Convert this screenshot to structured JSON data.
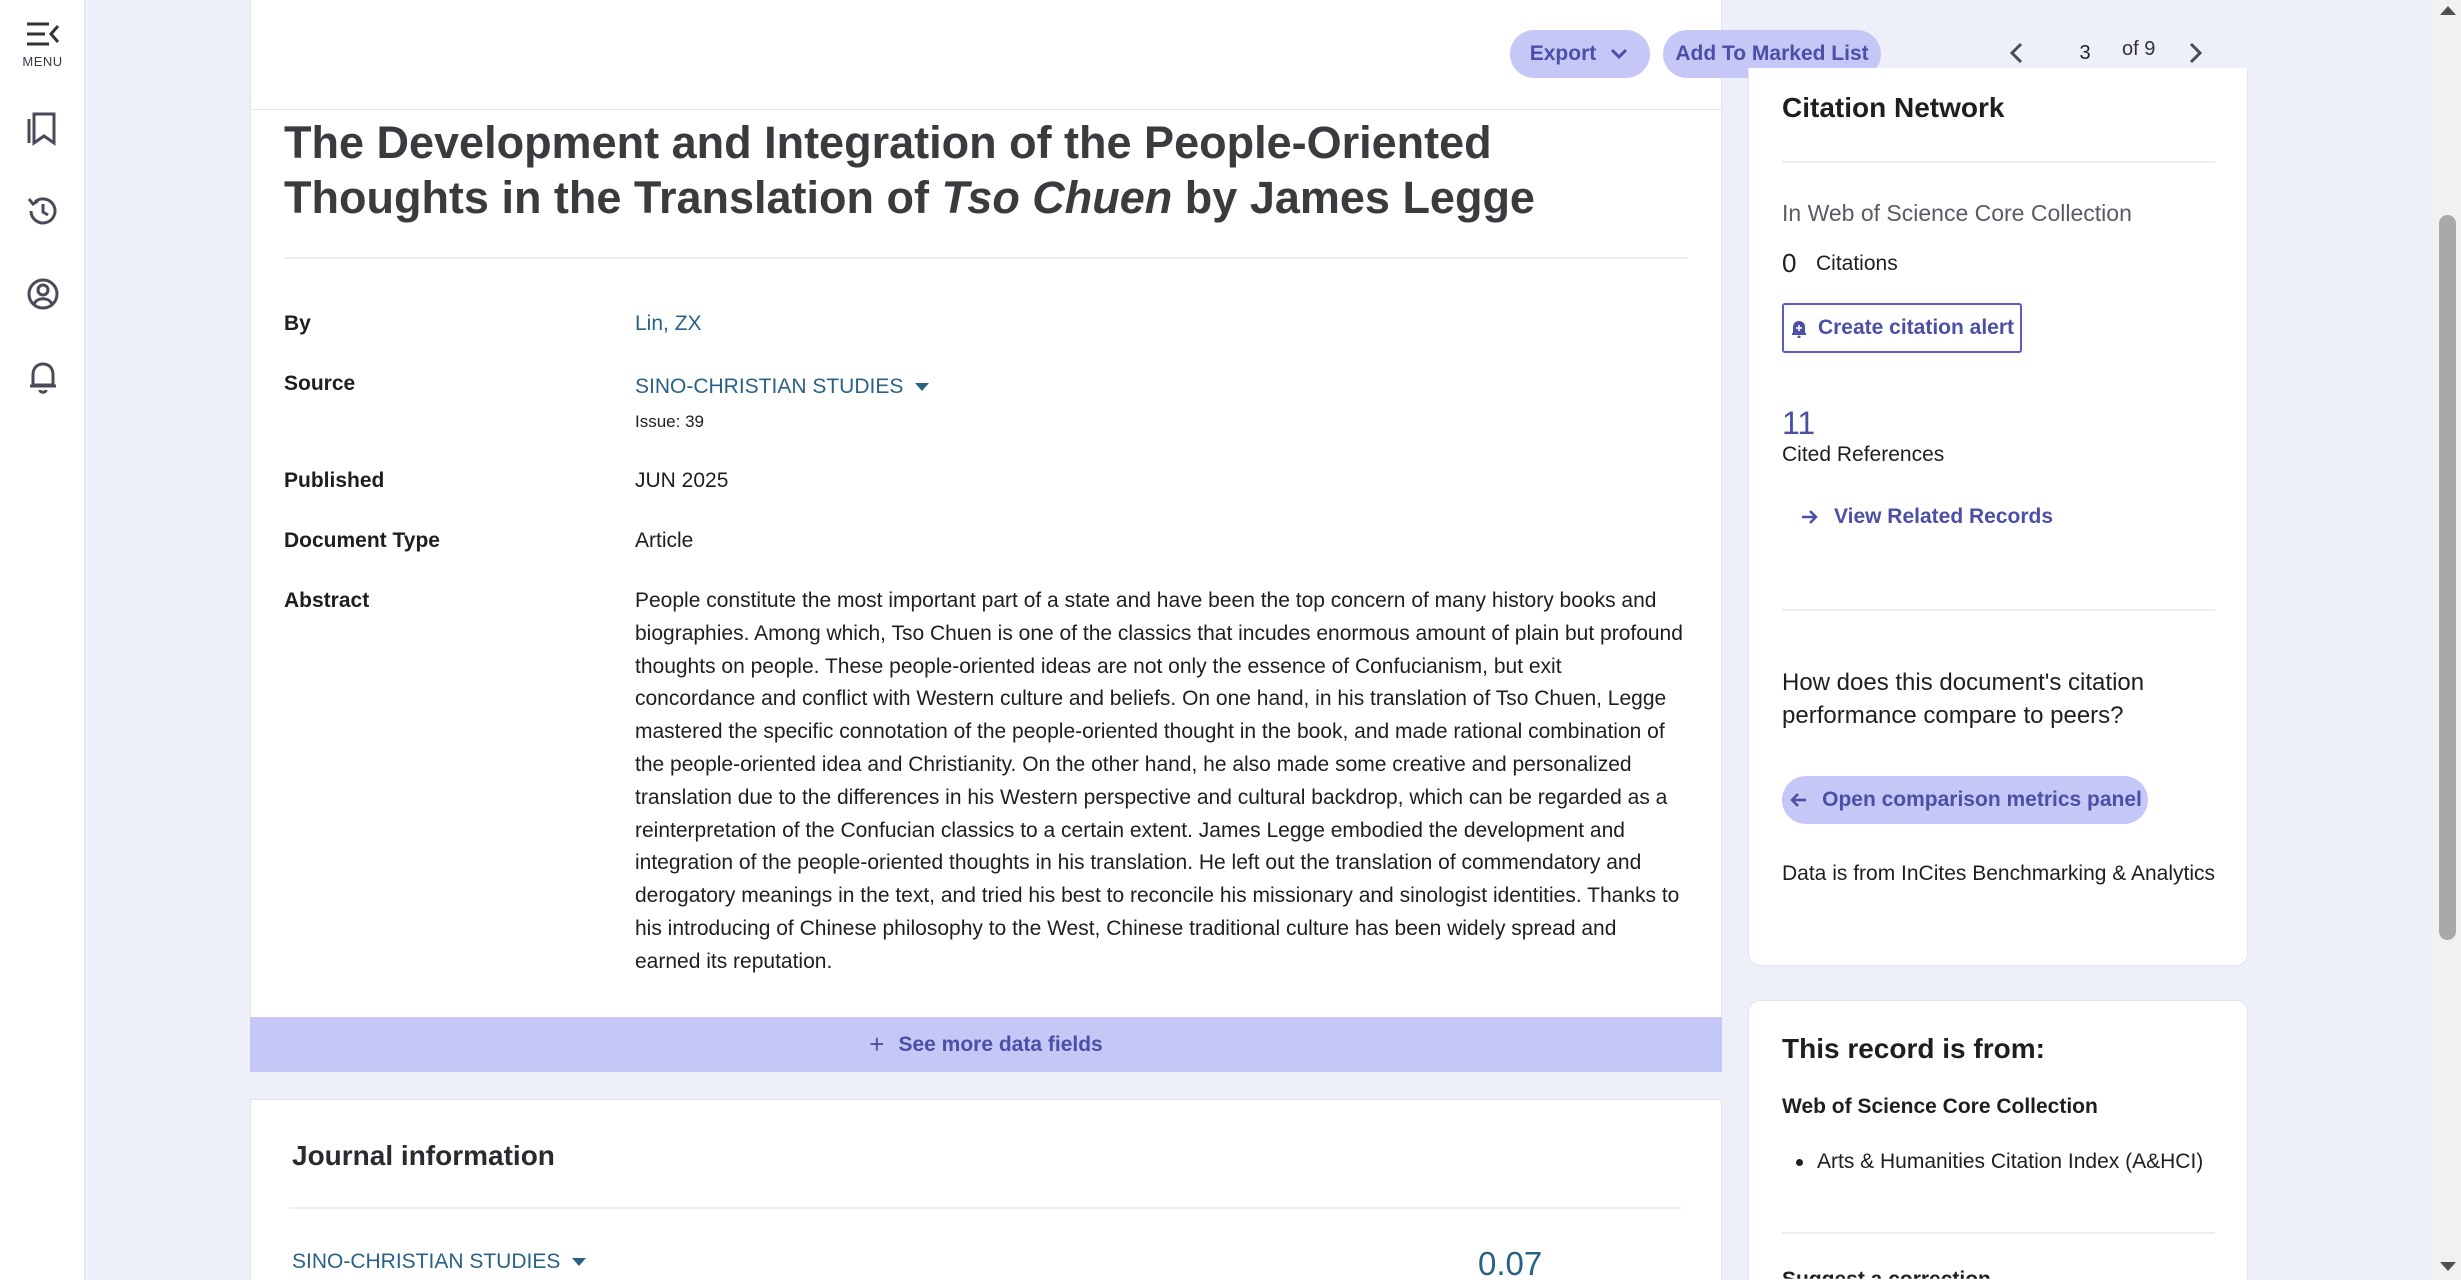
{
  "rail": {
    "menu_label": "MENU"
  },
  "toolbar": {
    "export_label": "Export",
    "marked_list_label": "Add To Marked List",
    "current_page": "3",
    "page_total_text": "of 9"
  },
  "record": {
    "title_part1": "The Development and Integration of the People-Oriented Thoughts in the Translation of ",
    "title_italic": "Tso Chuen",
    "title_part2": " by James Legge",
    "fields": {
      "by_label": "By",
      "by_value": "Lin, ZX",
      "source_label": "Source",
      "source_value": "SINO-CHRISTIAN STUDIES",
      "issue": "Issue: 39",
      "published_label": "Published",
      "published_value": "JUN 2025",
      "doctype_label": "Document Type",
      "doctype_value": "Article",
      "abstract_label": "Abstract",
      "abstract_value": "People constitute the most important part of a state and have been the top concern of many history books and biographies. Among which, Tso Chuen is one of the classics that incudes enormous amount of plain but profound thoughts on people. These people-oriented ideas are not only the essence of Confucianism, but exit concordance and conflict with Western culture and beliefs. On one hand, in his translation of Tso Chuen, Legge mastered the specific connotation of the people-oriented thought in the book, and made rational combination of the people-oriented idea and Christianity. On the other hand, he also made some creative and personalized translation due to the differences in his Western perspective and cultural backdrop, which can be regarded as a reinterpretation of the Confucian classics to a certain extent. James Legge embodied the development and integration of the people-oriented thoughts in his translation. He left out the translation of commendatory and derogatory meanings in the text, and tried his best to reconcile his missionary and sinologist identities. Thanks to his introducing of Chinese philosophy to the West, Chinese traditional culture has been widely spread and earned its reputation."
    },
    "see_more_label": "See more data fields"
  },
  "journal": {
    "heading": "Journal information",
    "name": "SINO-CHRISTIAN STUDIES",
    "metric": "0.07"
  },
  "citation": {
    "heading": "Citation Network",
    "collection_text": "In Web of Science Core Collection",
    "count": "0",
    "count_label": "Citations",
    "alert_label": "Create citation alert",
    "refs_count": "11",
    "refs_label": "Cited References",
    "related_label": "View Related Records",
    "compare_question": "How does this document's citation performance compare to peers?",
    "compare_button": "Open comparison metrics panel",
    "data_source": "Data is from InCites Benchmarking & Analytics"
  },
  "record_source": {
    "heading": "This record is from:",
    "collection": "Web of Science Core Collection",
    "index": "Arts & Humanities Citation Index (A&HCI)",
    "suggest": "Suggest a correction"
  },
  "colors": {
    "accent": "#4b4fa6",
    "pill_bg": "#c5c8f6",
    "link": "#2a6187"
  }
}
